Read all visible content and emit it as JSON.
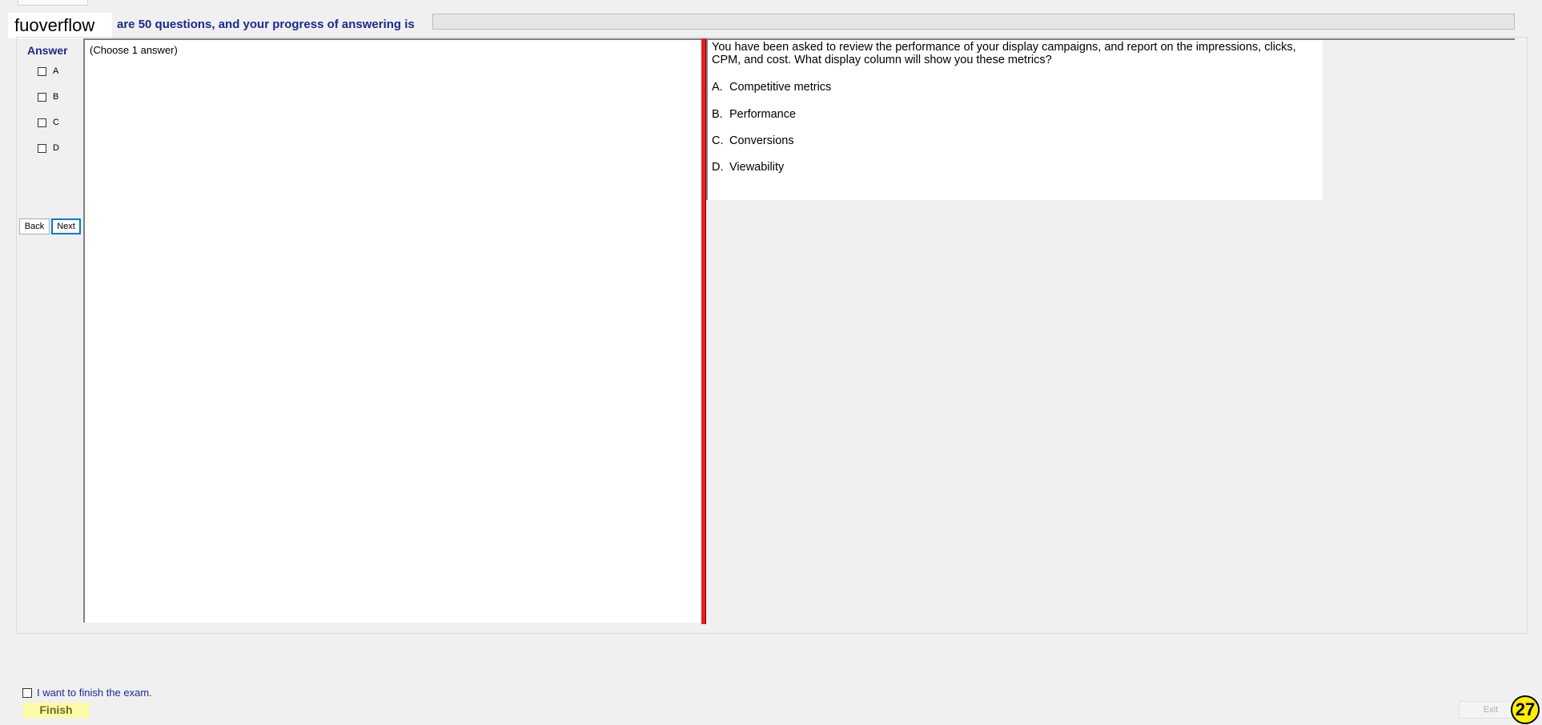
{
  "header": {
    "brand": "fuoverflow",
    "progress_text": "are 50 questions, and your progress of answering is",
    "progress_fraction": 0
  },
  "answer_panel": {
    "title": "Answer",
    "options": [
      "A",
      "B",
      "C",
      "D"
    ],
    "back_label": "Back",
    "next_label": "Next"
  },
  "left_pane": {
    "instruction": "(Choose 1 answer)"
  },
  "question": {
    "text": "You have been asked to review the performance of your display campaigns, and report on the impressions, clicks, CPM, and cost. What display column will show you these metrics?",
    "choices": [
      {
        "letter": "A.",
        "text": "Competitive metrics"
      },
      {
        "letter": "B.",
        "text": "Performance"
      },
      {
        "letter": "C.",
        "text": "Conversions"
      },
      {
        "letter": "D.",
        "text": "Viewability"
      }
    ]
  },
  "footer": {
    "finish_check_label": "I want to finish the exam.",
    "finish_label": "Finish",
    "exit_label": "Exit",
    "question_number": "27"
  },
  "colors": {
    "accent_blue": "#1a2a8f",
    "divider_red": "#e81c24",
    "finish_yellow": "#fffaa8",
    "badge_yellow": "#ffee00"
  }
}
